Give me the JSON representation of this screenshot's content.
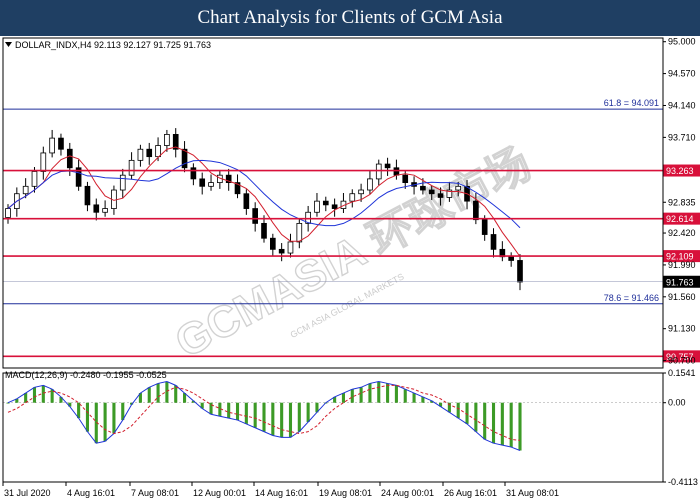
{
  "banner": {
    "title": "Chart Analysis for Clients of GCM Asia"
  },
  "watermark": {
    "text": "GCMASIA 环球市场",
    "subtext": "GCM ASIA GLOBAL MARKETS"
  },
  "colors": {
    "banner_bg": "#1f3f63",
    "bull_candle": "#ffffff",
    "bear_candle": "#000000",
    "ma_fast": "#d21f2d",
    "ma_slow": "#1f34d8",
    "level_red": "#d8103a",
    "level_blue": "#1f2f9a",
    "macd_hist": "#3c9a26",
    "macd_main": "#1f34d8",
    "macd_signal": "#d21f2d"
  },
  "chart_data": [
    {
      "type": "candlestick",
      "title": "DOLLAR_INDX,H4  92.113 92.127 91.725 91.763",
      "ylim": [
        90.6,
        95.05
      ],
      "y_ticks": [
        "95.000",
        "94.570",
        "94.140",
        "93.710",
        "92.835",
        "92.420",
        "91.990",
        "91.560",
        "91.130",
        "90.700"
      ],
      "x_ticks": [
        "31 Jul 2020",
        "4 Aug 16:01",
        "7 Aug 08:01",
        "12 Aug 00:01",
        "14 Aug 16:01",
        "19 Aug 08:01",
        "24 Aug 00:01",
        "26 Aug 16:01",
        "31 Aug 08:01"
      ],
      "current_price": "91.763",
      "levels": [
        {
          "value": 94.091,
          "label": "61.8 = 94.091",
          "color": "blue",
          "style": "label"
        },
        {
          "value": 93.263,
          "label": "93.263",
          "color": "red",
          "style": "box"
        },
        {
          "value": 92.614,
          "label": "92.614",
          "color": "red",
          "style": "box"
        },
        {
          "value": 92.109,
          "label": "92.109",
          "color": "red",
          "style": "box"
        },
        {
          "value": 91.466,
          "label": "78.6 = 91.466",
          "color": "blue",
          "style": "label"
        },
        {
          "value": 90.757,
          "label": "90.757",
          "color": "red",
          "style": "box"
        }
      ],
      "closes": [
        92.75,
        92.95,
        93.05,
        93.25,
        93.5,
        93.7,
        93.55,
        93.3,
        93.05,
        92.8,
        92.7,
        92.75,
        93.0,
        93.2,
        93.4,
        93.55,
        93.45,
        93.6,
        93.75,
        93.55,
        93.3,
        93.15,
        93.05,
        93.1,
        93.2,
        93.1,
        92.95,
        92.75,
        92.55,
        92.35,
        92.2,
        92.15,
        92.3,
        92.55,
        92.7,
        92.85,
        92.8,
        92.75,
        92.85,
        92.95,
        93.0,
        93.15,
        93.35,
        93.3,
        93.2,
        93.1,
        93.05,
        93.0,
        92.95,
        92.9,
        93.0,
        93.05,
        92.85,
        92.6,
        92.4,
        92.2,
        92.1,
        92.05,
        91.76
      ]
    },
    {
      "type": "macd",
      "title": "MACD(12,26,9) -0.2480 -0.1955 -0.0525",
      "ylim": [
        -0.4113,
        0.1541
      ],
      "y_ticks": [
        "0.1541",
        "0.00",
        "-0.4113"
      ],
      "main": [
        0.0,
        0.02,
        0.05,
        0.08,
        0.09,
        0.07,
        0.03,
        -0.02,
        -0.08,
        -0.15,
        -0.21,
        -0.2,
        -0.16,
        -0.09,
        -0.01,
        0.05,
        0.08,
        0.1,
        0.11,
        0.09,
        0.05,
        0.01,
        -0.03,
        -0.06,
        -0.07,
        -0.08,
        -0.09,
        -0.11,
        -0.13,
        -0.15,
        -0.17,
        -0.18,
        -0.18,
        -0.15,
        -0.1,
        -0.05,
        0.0,
        0.03,
        0.05,
        0.07,
        0.08,
        0.1,
        0.11,
        0.1,
        0.09,
        0.07,
        0.05,
        0.03,
        0.01,
        -0.02,
        -0.05,
        -0.08,
        -0.11,
        -0.15,
        -0.19,
        -0.21,
        -0.22,
        -0.23,
        -0.248
      ],
      "signal": [
        -0.05,
        -0.03,
        0.0,
        0.03,
        0.05,
        0.06,
        0.05,
        0.03,
        0.0,
        -0.05,
        -0.1,
        -0.14,
        -0.16,
        -0.15,
        -0.12,
        -0.07,
        -0.02,
        0.03,
        0.06,
        0.08,
        0.07,
        0.05,
        0.02,
        -0.01,
        -0.03,
        -0.05,
        -0.06,
        -0.07,
        -0.08,
        -0.1,
        -0.12,
        -0.14,
        -0.15,
        -0.16,
        -0.15,
        -0.12,
        -0.07,
        -0.03,
        0.0,
        0.03,
        0.05,
        0.07,
        0.08,
        0.09,
        0.09,
        0.08,
        0.07,
        0.05,
        0.04,
        0.02,
        -0.01,
        -0.03,
        -0.06,
        -0.09,
        -0.12,
        -0.15,
        -0.17,
        -0.19,
        -0.1955
      ]
    }
  ]
}
